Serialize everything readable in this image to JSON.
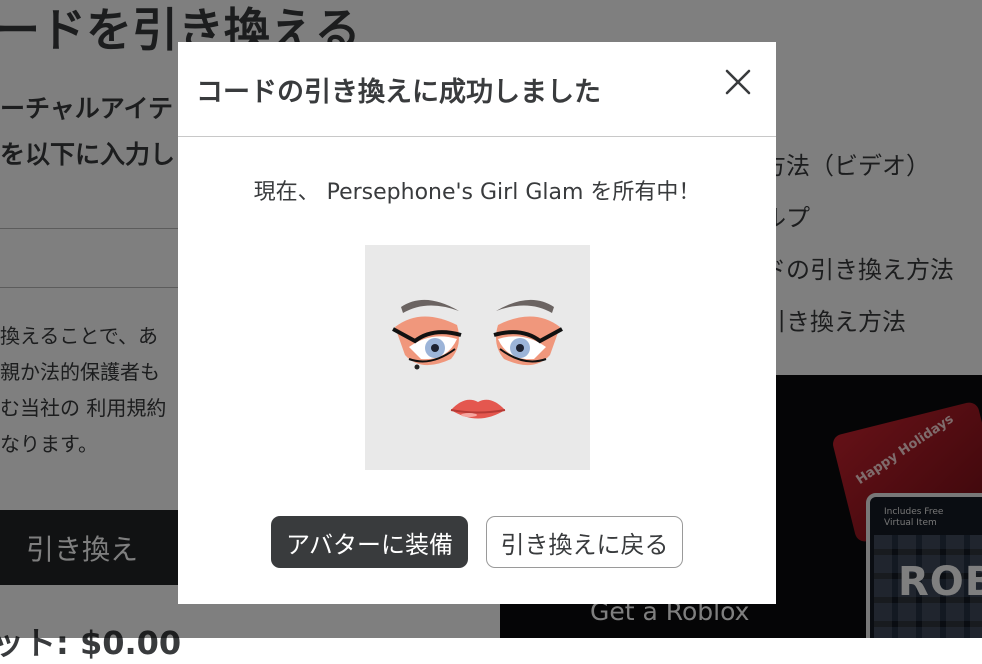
{
  "background": {
    "page_title": "ードを引き換える",
    "instructions": [
      "ーチャルアイテ",
      "を以下に入力し"
    ],
    "terms_lines": [
      "換えることで、あ",
      "親か法的保護者も",
      "む当社の 利用規約",
      "なります。"
    ],
    "redeem_button_label": "引き換え",
    "credit_text": "ット: $0.00",
    "help_links": [
      "方法（ビデオ）",
      "ルプ",
      "ドの引き換え方法",
      "引き換え方法"
    ],
    "promo": {
      "card_red_text": "Happy Holidays",
      "card_dark_text": "Includes Free\nVirtual Item",
      "card_logo": "ROB",
      "text": "Get a Roblox"
    }
  },
  "modal": {
    "title": "コードの引き換えに成功しました",
    "close_icon": "close-icon",
    "message": "現在、 Persephone's Girl Glam を所有中！",
    "item_thumbnail_icon": "makeup-face-icon",
    "primary_button_label": "アバターに装備",
    "secondary_button_label": "引き換えに戻る"
  },
  "colors": {
    "primary_button": "#393b3d",
    "overlay": "rgba(0,0,0,0.5)",
    "text": "#393b3d"
  }
}
